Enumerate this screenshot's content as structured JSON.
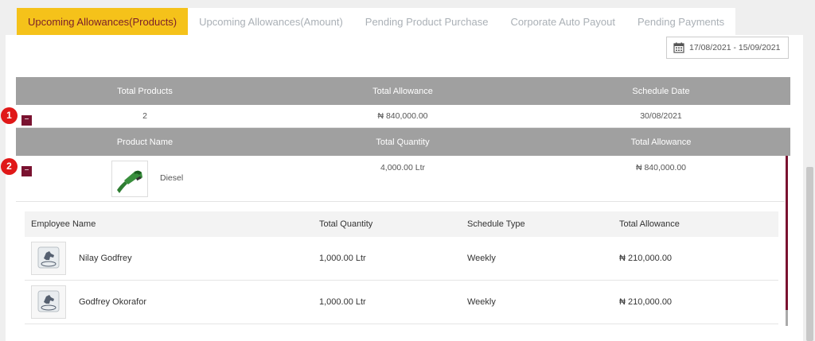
{
  "tabs": [
    {
      "label": "Upcoming Allowances(Products)",
      "active": true
    },
    {
      "label": "Upcoming Allowances(Amount)",
      "active": false
    },
    {
      "label": "Pending Product Purchase",
      "active": false
    },
    {
      "label": "Corporate Auto Payout",
      "active": false
    },
    {
      "label": "Pending Payments",
      "active": false
    }
  ],
  "date_range": "17/08/2021 - 15/09/2021",
  "summary": {
    "headers": [
      "Total Products",
      "Total Allowance",
      "Schedule Date"
    ],
    "row": {
      "total_products": "2",
      "total_allowance": "₦ 840,000.00",
      "schedule_date": "30/08/2021"
    }
  },
  "product_table": {
    "headers": [
      "Product Name",
      "Total Quantity",
      "Total Allowance"
    ],
    "row": {
      "name": "Diesel",
      "quantity": "4,000.00 Ltr",
      "allowance": "₦ 840,000.00"
    }
  },
  "employee_table": {
    "headers": [
      "Employee Name",
      "Total Quantity",
      "Schedule Type",
      "Total Allowance"
    ],
    "rows": [
      {
        "name": "Nilay Godfrey",
        "quantity": "1,000.00 Ltr",
        "schedule": "Weekly",
        "allowance": "₦ 210,000.00"
      },
      {
        "name": "Godfrey Okorafor",
        "quantity": "1,000.00 Ltr",
        "schedule": "Weekly",
        "allowance": "₦ 210,000.00"
      }
    ]
  },
  "badges": [
    "1",
    "2"
  ],
  "icons": {
    "calendar": "calendar-icon",
    "collapse": "minus-icon",
    "product": "fuel-nozzle-icon",
    "avatar": "horse-logo-icon"
  },
  "colors": {
    "accent": "#f5c21a",
    "brand": "#7a1230",
    "header": "#a0a0a0",
    "badge": "#e01818"
  }
}
